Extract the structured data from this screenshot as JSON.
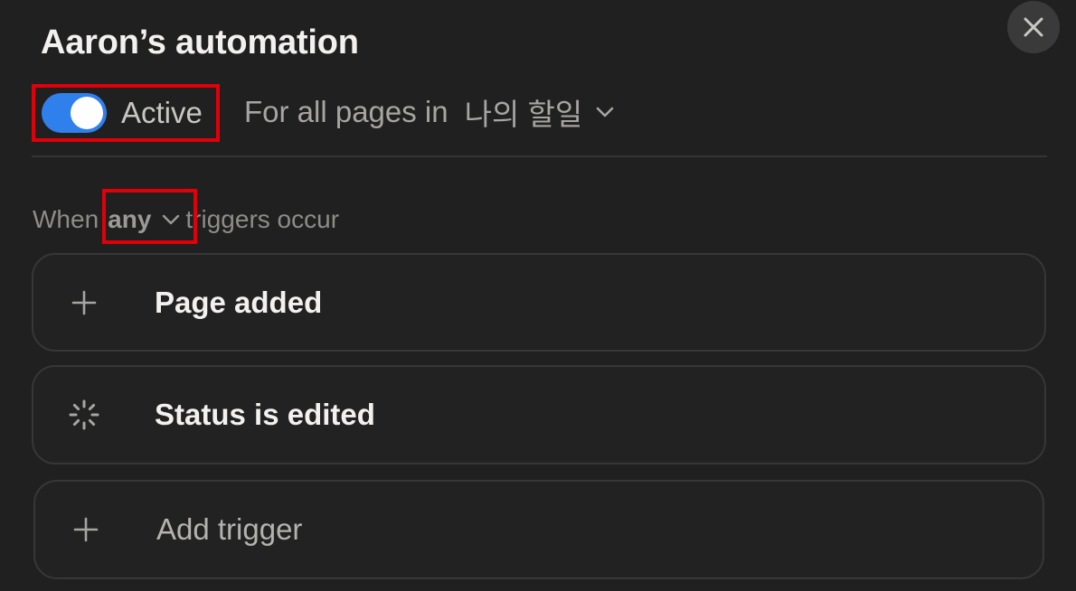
{
  "automation": {
    "title": "Aaron’s automation",
    "active": true,
    "active_label": "Active",
    "scope_prefix": "For all pages in",
    "database_name": "나의 할일"
  },
  "triggers": {
    "when_prefix": "When",
    "mode": "any",
    "when_suffix": "triggers occur",
    "items": [
      {
        "label": "Page added",
        "icon": "plus-icon"
      },
      {
        "label": "Status is edited",
        "icon": "status-loader-icon"
      }
    ],
    "add_label": "Add trigger"
  },
  "colors": {
    "background": "#202020",
    "toggle_on": "#2f80ed",
    "highlight": "#e0000a"
  },
  "icons": {
    "close": "close-icon",
    "chevron": "chevron-down-icon",
    "add": "plus-icon"
  }
}
